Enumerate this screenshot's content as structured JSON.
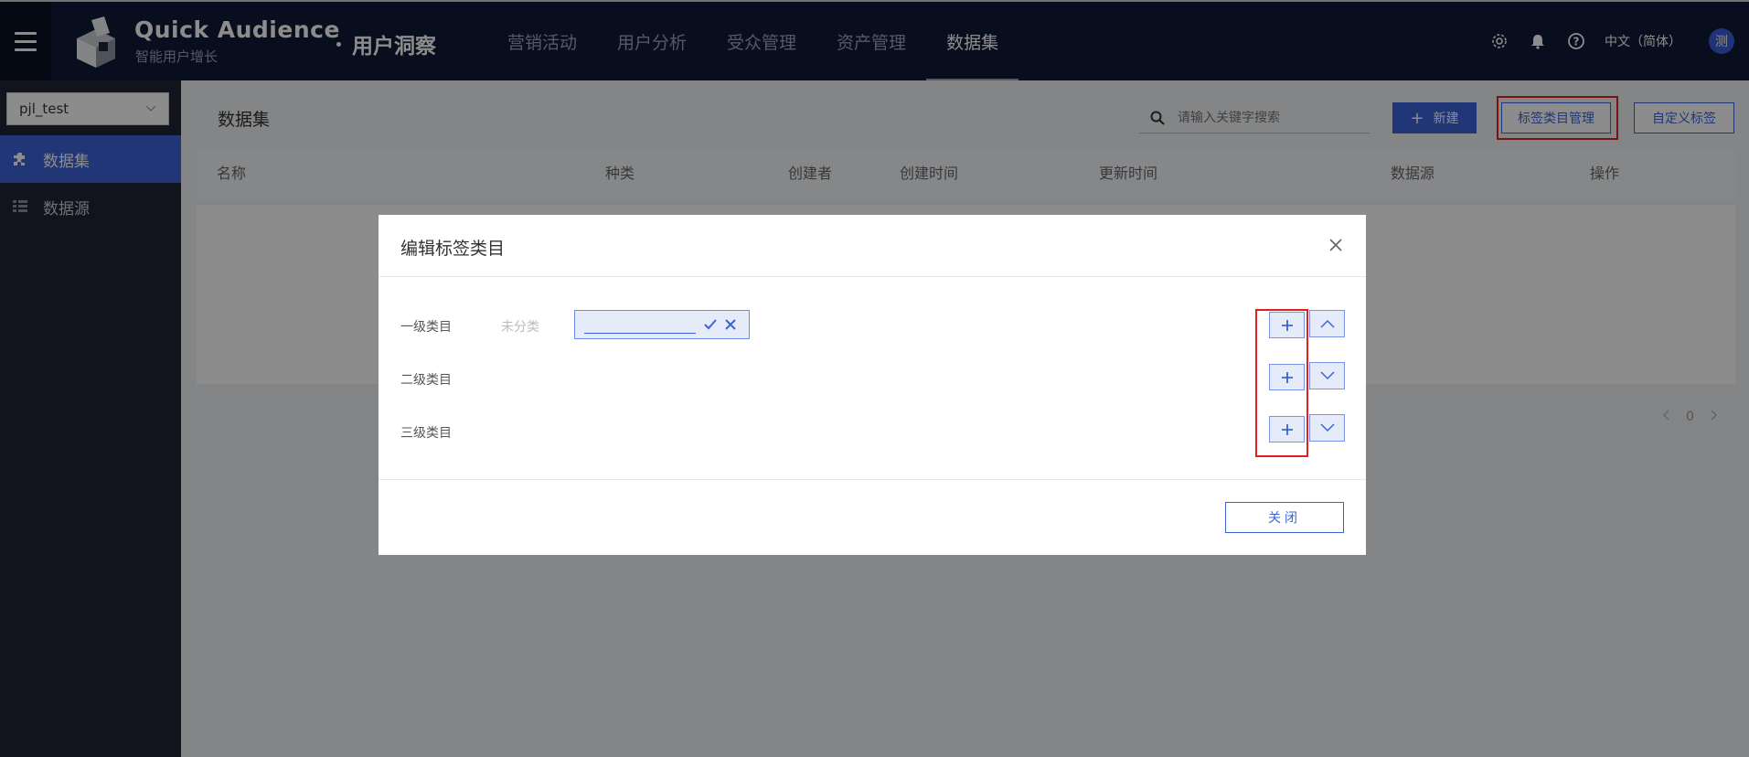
{
  "header": {
    "brand": "Quick Audience",
    "brand_sub": "智能用户增长",
    "product": "用户洞察",
    "nav": [
      "营销活动",
      "用户分析",
      "受众管理",
      "资产管理",
      "数据集"
    ],
    "language": "中文（简体）",
    "avatar_text": "测"
  },
  "sidebar": {
    "workspace": "pjl_test",
    "items": [
      {
        "label": "数据集",
        "icon": "puzzle-icon",
        "active": true
      },
      {
        "label": "数据源",
        "icon": "table-icon",
        "active": false
      }
    ]
  },
  "main": {
    "title": "数据集",
    "search_placeholder": "请输入关键字搜索",
    "new_button": "新建",
    "tag_category_button": "标签类目管理",
    "custom_tag_button": "自定义标签",
    "columns": [
      "名称",
      "种类",
      "创建者",
      "创建时间",
      "更新时间",
      "数据源",
      "操作"
    ],
    "pager_count": "0"
  },
  "modal": {
    "title": "编辑标签类目",
    "rows": [
      {
        "label": "一级类目"
      },
      {
        "label": "二级类目"
      },
      {
        "label": "三级类目"
      }
    ],
    "uncategorized": "未分类",
    "edit_value": "",
    "close_button": "关闭"
  },
  "colors": {
    "header_bg": "#0f1a36",
    "sidebar_bg": "#1f2535",
    "accent": "#3b63d9",
    "highlight": "#e02020"
  }
}
